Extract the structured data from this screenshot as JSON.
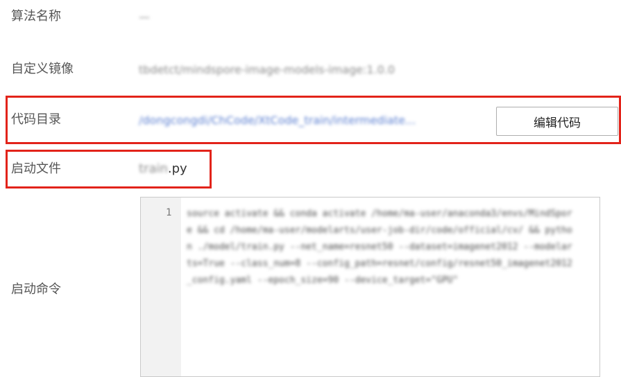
{
  "fields": {
    "algorithm_name": {
      "label": "算法名称",
      "value": "—"
    },
    "custom_image": {
      "label": "自定义镜像",
      "value": "tbdetct/mindspore-image-models-image:1.0.0"
    },
    "code_dir": {
      "label": "代码目录",
      "value": "/dongcongdi/ChCode/XtCode_train/intermediate...",
      "button": "编辑代码"
    },
    "boot_file": {
      "label": "启动文件",
      "value_prefix": "train",
      "value_suffix": ".py"
    },
    "boot_command": {
      "label": "启动命令",
      "line_number": "1",
      "code": "source activate && conda activate /home/ma-user/anaconda3/envs/MindSpore && cd /home/ma-user/modelarts/user-job-dir/code/official/cv/ && python ./model/train.py --net_name=resnet50 --dataset=imagenet2012 --modelarts=True --class_num=8 --config_path=resnet/config/resnet50_imagenet2012_config.yaml --epoch_size=90 --device_target=\"GPU\""
    }
  },
  "colors": {
    "highlight": "#e2231a",
    "link": "#5b7fd1"
  }
}
